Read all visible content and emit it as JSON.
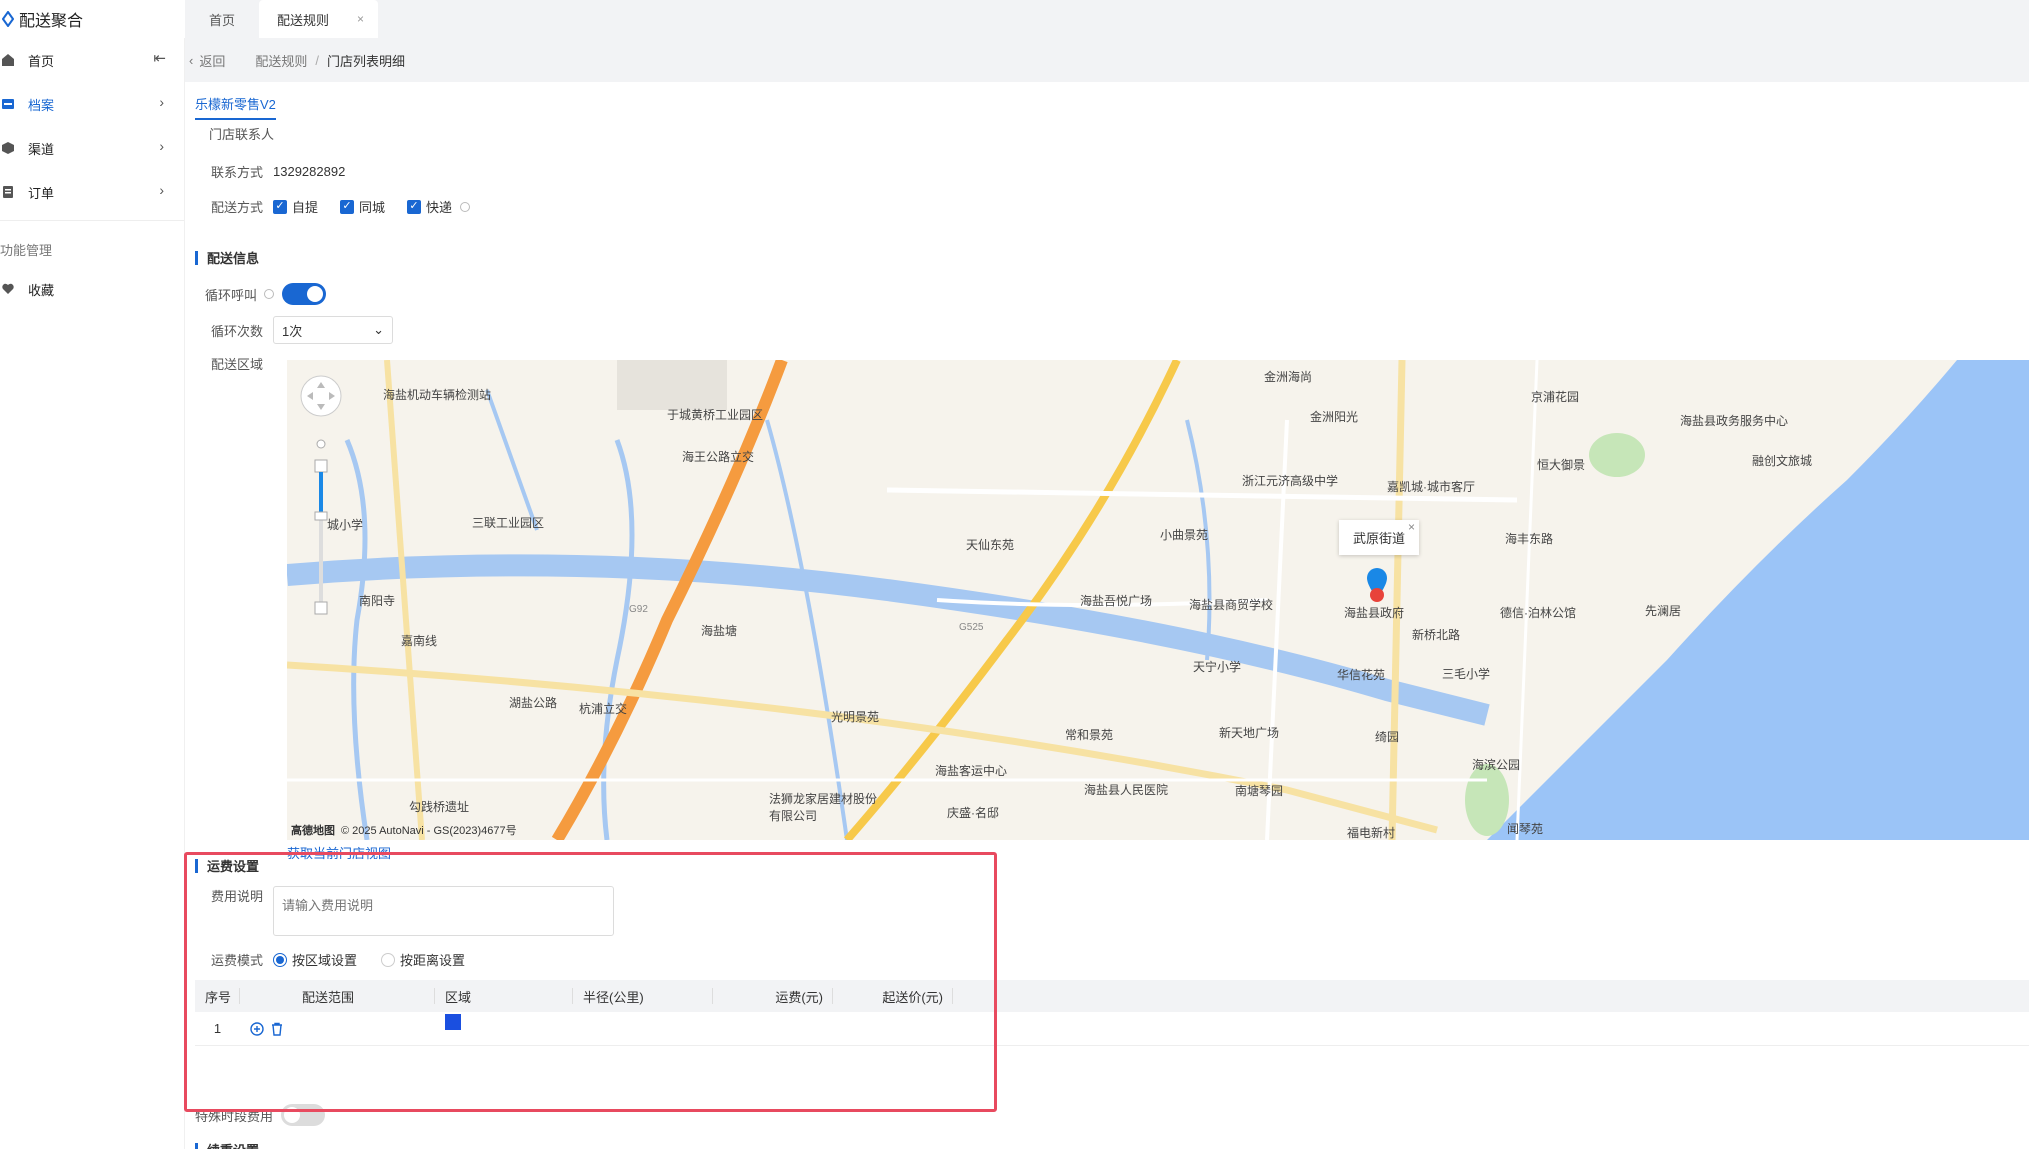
{
  "app": {
    "title": "配送聚合"
  },
  "tabs": [
    {
      "label": "首页"
    },
    {
      "label": "配送规则",
      "close": "×"
    }
  ],
  "sidebar": {
    "collapse_icon": "collapse-left-icon",
    "items": [
      {
        "label": "首页",
        "icon": "home-icon"
      },
      {
        "label": "档案",
        "icon": "archive-icon",
        "active": true
      },
      {
        "label": "渠道",
        "icon": "cube-icon"
      },
      {
        "label": "订单",
        "icon": "order-icon"
      }
    ],
    "group_label": "功能管理",
    "group_items": [
      {
        "label": "收藏",
        "icon": "heart-icon"
      }
    ]
  },
  "breadcrumb": {
    "back": "返回",
    "parent": "配送规则",
    "sep": "/",
    "current": "门店列表明细"
  },
  "store": {
    "tab": "乐檬新零售V2",
    "contact_label": "门店联系人",
    "phone_label": "联系方式",
    "phone": "1329282892",
    "delivery_label": "配送方式",
    "delivery_options": [
      {
        "label": "自提",
        "checked": true
      },
      {
        "label": "同城",
        "checked": true
      },
      {
        "label": "快递",
        "checked": true
      }
    ]
  },
  "delivery_info": {
    "title": "配送信息",
    "loop_call_label": "循环呼叫",
    "loop_call_on": true,
    "loop_count_label": "循环次数",
    "loop_count_value": "1次",
    "area_label": "配送区域"
  },
  "map": {
    "popup": "武原街道",
    "popup_close": "×",
    "copyright": "© 2025 AutoNavi - GS(2023)4677号",
    "logo": "高德地图",
    "link": "获取当前门店视图",
    "labels": [
      "海盐机动车辆检测站",
      "于城黄桥工业园区",
      "海王公路立交",
      "三联工业园区",
      "天仙东苑",
      "小曲景苑",
      "浙江元济高级中学",
      "嘉凯城·城市客厅",
      "金洲海尚",
      "金洲阳光",
      "京浦花园",
      "海盐县政务服务中心",
      "恒大御景",
      "融创文旅城",
      "海丰东路",
      "海盐县政府",
      "德信·泊林公馆",
      "先澜居",
      "华信花苑",
      "三毛小学",
      "海盐吾悦广场",
      "海盐县商贸学校",
      "天宁小学",
      "新天地广场",
      "绮园",
      "海滨公园",
      "南塘琴园",
      "海盐县人民医院",
      "海盐客运中心",
      "常和景苑",
      "光明景苑",
      "法狮龙家居建材股份有限公司",
      "庆盛·名邸",
      "杭浦立交",
      "湖盐公路",
      "勾践桥遗址",
      "南阳寺",
      "城小学",
      "嘉南线",
      "闻琴苑",
      "福电新村",
      "海盐塘",
      "G92",
      "G525",
      "新桥北路"
    ]
  },
  "fee": {
    "title": "运费设置",
    "desc_label": "费用说明",
    "desc_placeholder": "请输入费用说明",
    "mode_label": "运费模式",
    "modes": [
      {
        "label": "按区域设置",
        "checked": true
      },
      {
        "label": "按距离设置",
        "checked": false
      }
    ],
    "table_headers": [
      "序号",
      "配送范围",
      "区域",
      "半径(公里)",
      "运费(元)",
      "起送价(元)"
    ],
    "rows": [
      {
        "no": "1",
        "area_color": "#1a4fe0"
      }
    ],
    "special_label": "特殊时段费用",
    "next_section": "续重设置"
  },
  "colors": {
    "accent": "#1967d2",
    "highlight": "#e84a5f"
  }
}
